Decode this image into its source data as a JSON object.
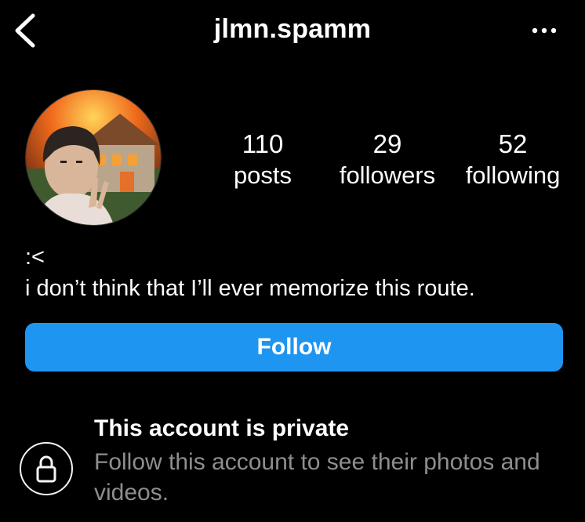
{
  "header": {
    "username": "jlmn.spamm",
    "back_icon": "chevron-left-icon",
    "more_icon": "ellipsis-icon"
  },
  "profile": {
    "avatar_alt": "profile photo",
    "stats": [
      {
        "value": "110",
        "label": "posts"
      },
      {
        "value": "29",
        "label": "followers"
      },
      {
        "value": "52",
        "label": "following"
      }
    ],
    "bio_lines": [
      ":<",
      "i don’t think that I’ll ever memorize this route."
    ]
  },
  "actions": {
    "follow_label": "Follow",
    "follow_color": "#1f95f2"
  },
  "private_notice": {
    "title": "This account is private",
    "subtitle": "Follow this account to see their photos and videos.",
    "icon": "lock-icon"
  }
}
